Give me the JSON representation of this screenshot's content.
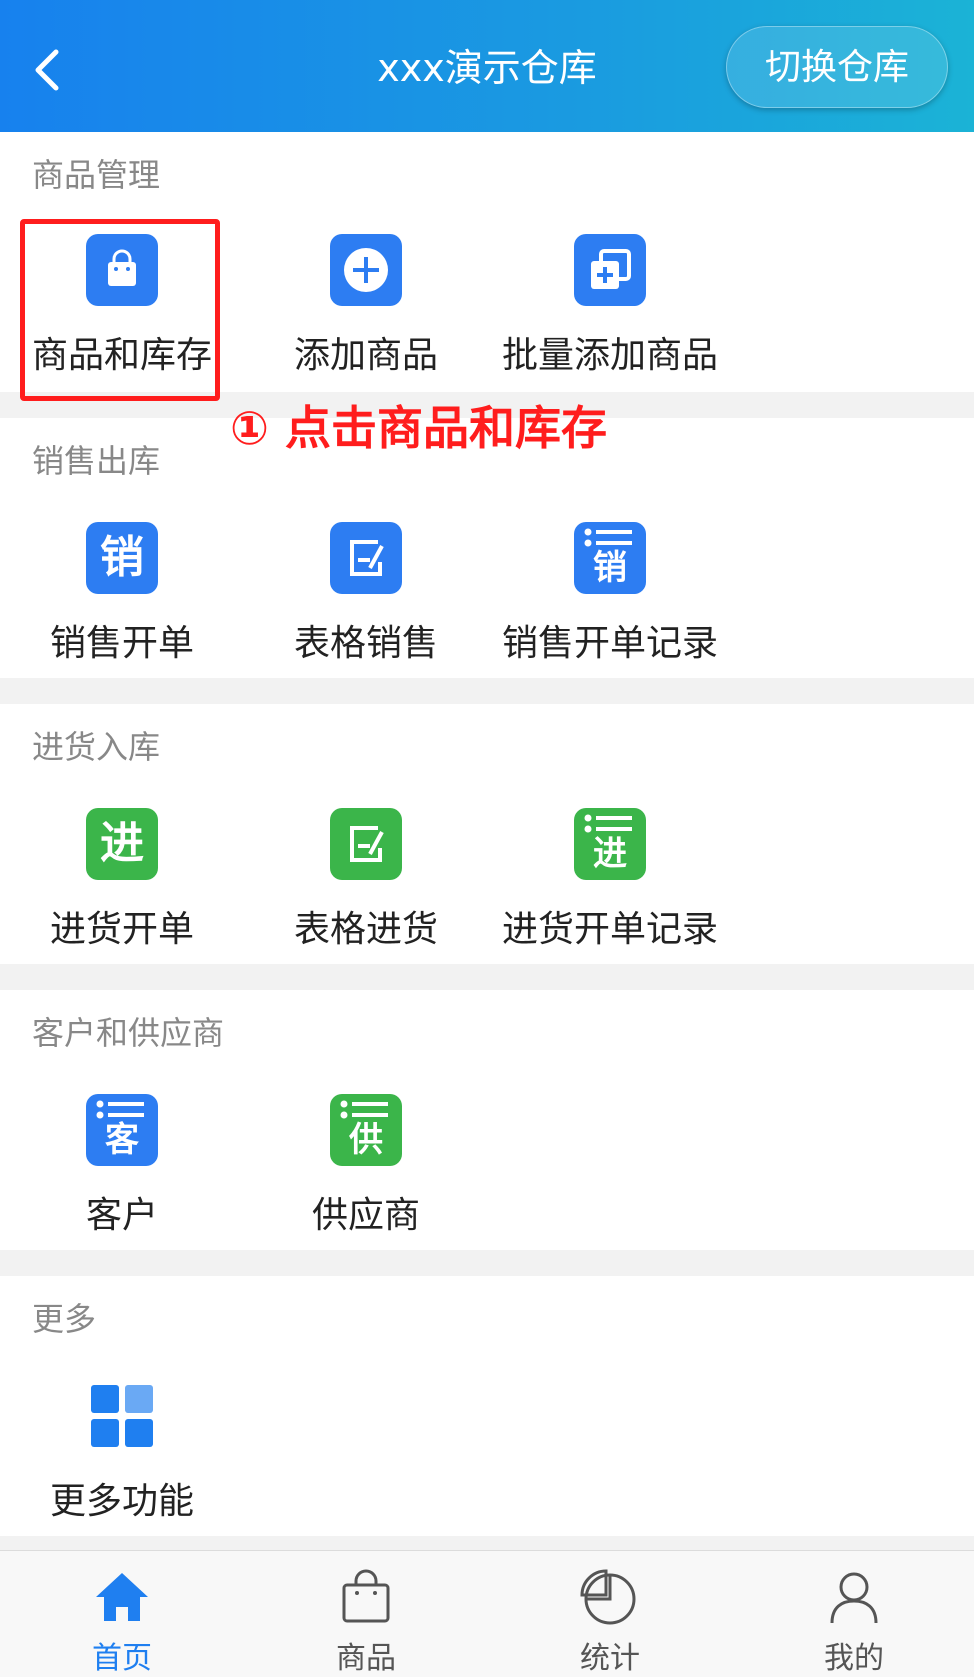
{
  "header": {
    "title": "xxx演示仓库",
    "switch_label": "切换仓库"
  },
  "sections": {
    "goods": {
      "title": "商品管理",
      "items": [
        {
          "label": "商品和库存"
        },
        {
          "label": "添加商品"
        },
        {
          "label": "批量添加商品"
        }
      ]
    },
    "sales": {
      "title": "销售出库",
      "items": [
        {
          "label": "销售开单",
          "glyph": "销"
        },
        {
          "label": "表格销售"
        },
        {
          "label": "销售开单记录",
          "glyph": "销"
        }
      ]
    },
    "purchase": {
      "title": "进货入库",
      "items": [
        {
          "label": "进货开单",
          "glyph": "进"
        },
        {
          "label": "表格进货"
        },
        {
          "label": "进货开单记录",
          "glyph": "进"
        }
      ]
    },
    "partners": {
      "title": "客户和供应商",
      "items": [
        {
          "label": "客户",
          "glyph": "客"
        },
        {
          "label": "供应商",
          "glyph": "供"
        }
      ]
    },
    "more": {
      "title": "更多",
      "items": [
        {
          "label": "更多功能"
        }
      ]
    }
  },
  "annotation": "① 点击商品和库存",
  "tabbar": {
    "tabs": [
      {
        "label": "首页",
        "icon": "home-icon",
        "active": true
      },
      {
        "label": "商品",
        "icon": "bag-icon"
      },
      {
        "label": "统计",
        "icon": "pie-chart-icon"
      },
      {
        "label": "我的",
        "icon": "user-icon"
      }
    ]
  },
  "colors": {
    "accent": "#1f7ff0",
    "blue_icon": "#2d7df2",
    "green_icon": "#3bb54a",
    "annotation": "#ff1d1d"
  }
}
